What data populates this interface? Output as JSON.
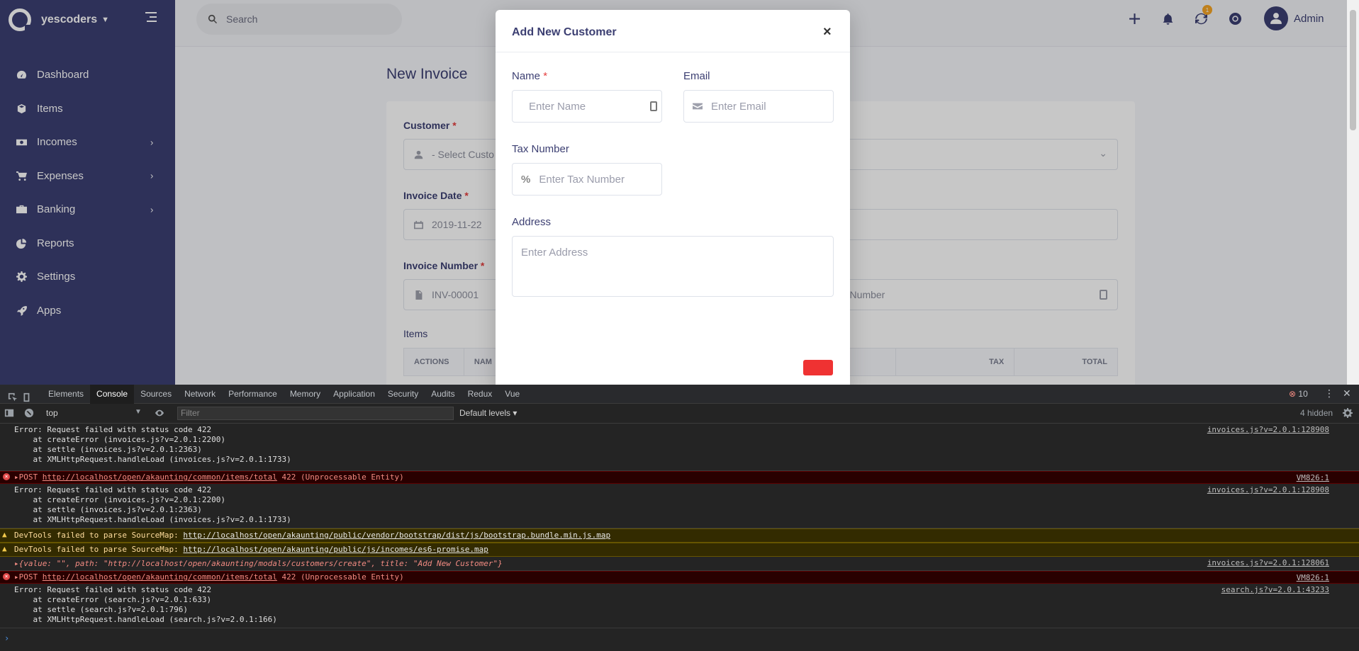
{
  "sidebar": {
    "company": "yescoders",
    "items": [
      {
        "label": "Dashboard",
        "icon": "dashboard-icon",
        "has_children": false
      },
      {
        "label": "Items",
        "icon": "cube-icon",
        "has_children": false
      },
      {
        "label": "Incomes",
        "icon": "money-icon",
        "has_children": true
      },
      {
        "label": "Expenses",
        "icon": "cart-icon",
        "has_children": true
      },
      {
        "label": "Banking",
        "icon": "briefcase-icon",
        "has_children": true
      },
      {
        "label": "Reports",
        "icon": "pie-chart-icon",
        "has_children": false
      },
      {
        "label": "Settings",
        "icon": "gear-icon",
        "has_children": false
      },
      {
        "label": "Apps",
        "icon": "rocket-icon",
        "has_children": false
      }
    ]
  },
  "topbar": {
    "search_placeholder": "Search",
    "notification_badge": "1",
    "user_name": "Admin"
  },
  "invoice": {
    "title": "New Invoice",
    "customer_label": "Customer",
    "customer_placeholder": "- Select Custo",
    "date_label": "Invoice Date",
    "date_value": "2019-11-22",
    "number_label": "Invoice Number",
    "number_value": "INV-00001",
    "order_placeholder": "r Number",
    "items_label": "Items",
    "table_headers": [
      "ACTIONS",
      "NAM",
      "ICE",
      "TAX",
      "TOTAL"
    ]
  },
  "modal": {
    "title": "Add New Customer",
    "name_label": "Name",
    "name_placeholder": "Enter Name",
    "email_label": "Email",
    "email_placeholder": "Enter Email",
    "tax_label": "Tax Number",
    "tax_placeholder": "Enter Tax Number",
    "address_label": "Address",
    "address_placeholder": "Enter Address"
  },
  "devtools": {
    "tabs": [
      "Elements",
      "Console",
      "Sources",
      "Network",
      "Performance",
      "Memory",
      "Application",
      "Security",
      "Audits",
      "Redux",
      "Vue"
    ],
    "active_tab": "Console",
    "error_count": "10",
    "context": "top",
    "filter_placeholder": "Filter",
    "levels": "Default levels",
    "hidden": "4 hidden",
    "lines": [
      {
        "type": "stack",
        "text": "Error: Request failed with status code 422\n    at createError (invoices.js?v=2.0.1:2200)\n    at settle (invoices.js?v=2.0.1:2363)\n    at XMLHttpRequest.handleLoad (invoices.js?v=2.0.1:1733)",
        "src": "invoices.js?v=2.0.1:128908"
      },
      {
        "type": "error",
        "method": "POST",
        "url": "http://localhost/open/akaunting/common/items/total",
        "status": "422 (Unprocessable Entity)",
        "src": "VM826:1"
      },
      {
        "type": "stack",
        "text": "Error: Request failed with status code 422\n    at createError (invoices.js?v=2.0.1:2200)\n    at settle (invoices.js?v=2.0.1:2363)\n    at XMLHttpRequest.handleLoad (invoices.js?v=2.0.1:1733)",
        "src": "invoices.js?v=2.0.1:128908"
      },
      {
        "type": "warn",
        "text": "DevTools failed to parse SourceMap: ",
        "url": "http://localhost/open/akaunting/public/vendor/bootstrap/dist/js/bootstrap.bundle.min.js.map",
        "src": ""
      },
      {
        "type": "warn",
        "text": "DevTools failed to parse SourceMap: ",
        "url": "http://localhost/open/akaunting/public/js/incomes/es6-promise.map",
        "src": ""
      },
      {
        "type": "object",
        "text": "{value: \"\", path: \"http://localhost/open/akaunting/modals/customers/create\", title: \"Add New Customer\"}",
        "src": "invoices.js?v=2.0.1:128061"
      },
      {
        "type": "error",
        "method": "POST",
        "url": "http://localhost/open/akaunting/common/items/total",
        "status": "422 (Unprocessable Entity)",
        "src": "VM826:1"
      },
      {
        "type": "stack",
        "text": "Error: Request failed with status code 422\n    at createError (search.js?v=2.0.1:633)\n    at settle (search.js?v=2.0.1:796)\n    at XMLHttpRequest.handleLoad (search.js?v=2.0.1:166)",
        "src": "search.js?v=2.0.1:43233"
      }
    ]
  }
}
